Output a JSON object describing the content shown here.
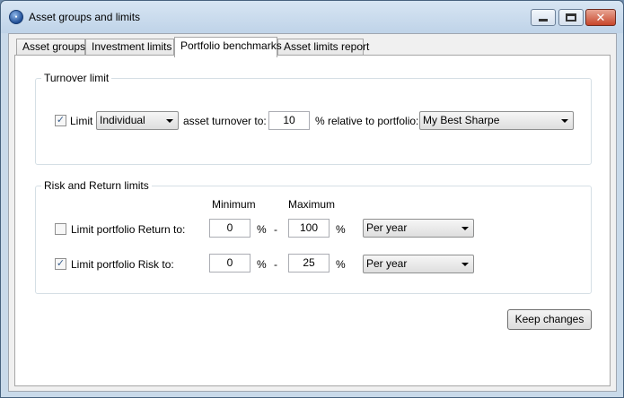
{
  "window": {
    "title": "Asset groups and limits",
    "icon": "app-logo-icon",
    "controls": {
      "minimize": "minimize-icon",
      "maximize": "maximize-icon",
      "close": "close-icon"
    }
  },
  "tabs": [
    {
      "label": "Asset groups",
      "active": false
    },
    {
      "label": "Investment limits",
      "active": false
    },
    {
      "label": "Portfolio benchmarks",
      "active": true
    },
    {
      "label": "Asset limits report",
      "active": false
    }
  ],
  "turnover": {
    "title": "Turnover limit",
    "limit_checked": true,
    "check_mark": "✓",
    "limit_label": "Limit",
    "mode_value": "Individual",
    "asset_turnover_label": "asset turnover to:",
    "percent_value": "10",
    "relative_label": "% relative to portfolio:",
    "portfolio_value": "My Best Sharpe"
  },
  "risk_return": {
    "title": "Risk and Return limits",
    "min_header": "Minimum",
    "max_header": "Maximum",
    "return_row": {
      "checked": false,
      "label": "Limit portfolio Return to:",
      "min_value": "0",
      "max_value": "100",
      "period_value": "Per year"
    },
    "risk_row": {
      "checked": true,
      "check_mark": "✓",
      "label": "Limit portfolio Risk to:",
      "min_value": "0",
      "max_value": "25",
      "period_value": "Per year"
    },
    "percent_sign": "%",
    "dash": "-"
  },
  "actions": {
    "keep_changes_label": "Keep changes"
  }
}
